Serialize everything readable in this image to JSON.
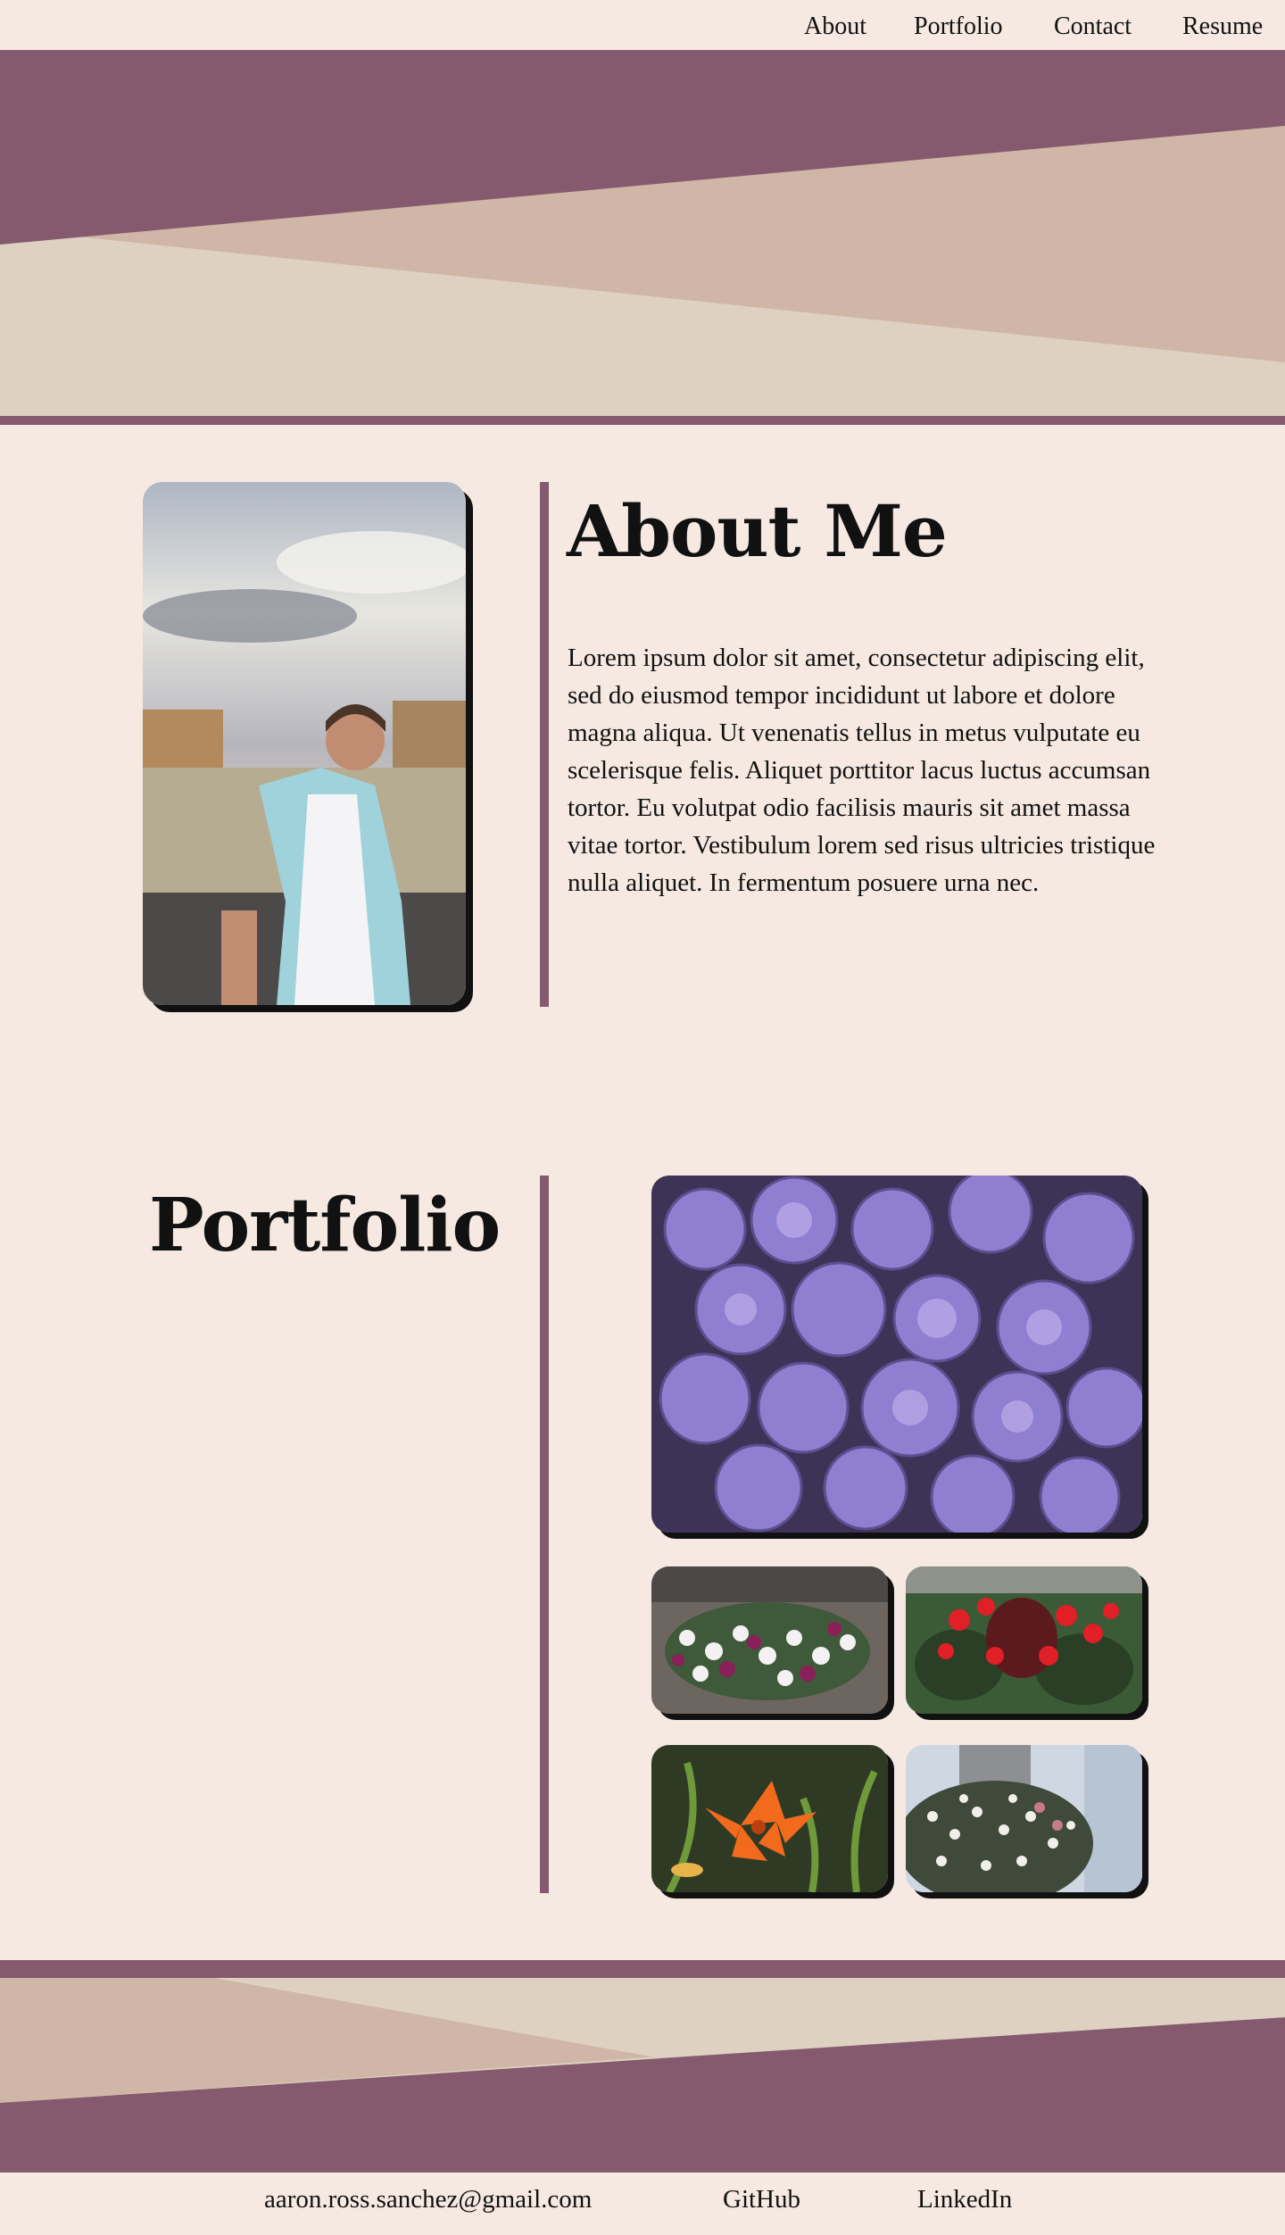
{
  "nav": {
    "items": [
      {
        "label": "About"
      },
      {
        "label": "Portfolio"
      },
      {
        "label": "Contact"
      },
      {
        "label": "Resume"
      }
    ]
  },
  "colors": {
    "background": "#f5e9e2",
    "plum": "#855a6f",
    "tan": "#cfb6a6",
    "beige": "#ded1c2",
    "text": "#111111"
  },
  "about": {
    "heading": "About Me",
    "body": "Lorem ipsum dolor sit amet, consectetur adipiscing elit, sed do eiusmod tempor incididunt ut labore et dolore magna aliqua. Ut venenatis tellus in metus vulputate eu scelerisque felis. Aliquet porttitor lacus luctus accumsan tortor. Eu volutpat odio facilisis mauris sit amet massa vitae tortor. Vestibulum lorem sed risus ultricies tristique nulla aliquet. In fermentum posuere urna nec."
  },
  "portfolio": {
    "heading": "Portfolio"
  },
  "footer": {
    "email": "aaron.ross.sanchez@gmail.com",
    "github": "GitHub",
    "linkedin": "LinkedIn"
  }
}
